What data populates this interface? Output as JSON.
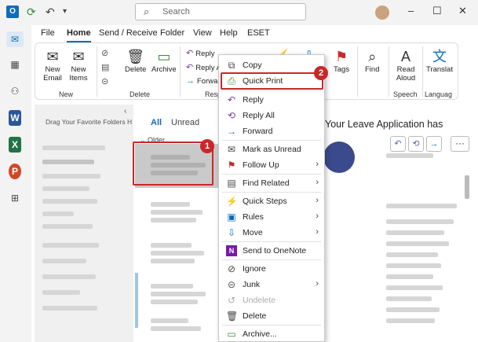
{
  "titlebar": {
    "search_placeholder": "Search",
    "undo_icon": "undo-icon",
    "refresh_icon": "refresh-icon",
    "minimize": "–",
    "maximize": "☐",
    "close": "✕"
  },
  "menu_tabs": [
    "File",
    "Home",
    "Send / Receive",
    "Folder",
    "View",
    "Help",
    "ESET"
  ],
  "ribbon": {
    "new_email": "New Email",
    "new_items": "New Items",
    "group_new": "New",
    "delete": "Delete",
    "archive": "Archive",
    "group_delete": "Delete",
    "reply": "Reply",
    "reply_all": "Reply A",
    "forward": "Forwar",
    "group_respond": "Resp",
    "tags": "Tags",
    "find": "Find",
    "read_aloud": "Read Aloud",
    "group_speech": "Speech",
    "translate": "Translat",
    "group_language": "Languag"
  },
  "folder_pane": {
    "drag_hint": "Drag Your Favorite Folders H"
  },
  "message_list": {
    "tab_all": "All",
    "tab_unread": "Unread",
    "group_older": "Older"
  },
  "reading_pane": {
    "subject": "Your Leave Application has"
  },
  "context_menu": {
    "items": [
      {
        "label": "Copy",
        "icon": "copy-icon",
        "submenu": false,
        "disabled": false
      },
      {
        "label": "Quick Print",
        "icon": "quick-print-icon",
        "submenu": false,
        "disabled": false
      },
      {
        "label": "Reply",
        "icon": "reply-icon",
        "submenu": false,
        "disabled": false
      },
      {
        "label": "Reply All",
        "icon": "reply-all-icon",
        "submenu": false,
        "disabled": false
      },
      {
        "label": "Forward",
        "icon": "forward-icon",
        "submenu": false,
        "disabled": false
      },
      {
        "label": "Mark as Unread",
        "icon": "mail-icon",
        "submenu": false,
        "disabled": false
      },
      {
        "label": "Follow Up",
        "icon": "flag-icon",
        "submenu": true,
        "disabled": false
      },
      {
        "label": "Find Related",
        "icon": "find-related-icon",
        "submenu": true,
        "disabled": false
      },
      {
        "label": "Quick Steps",
        "icon": "lightning-icon",
        "submenu": true,
        "disabled": false
      },
      {
        "label": "Rules",
        "icon": "rules-icon",
        "submenu": true,
        "disabled": false
      },
      {
        "label": "Move",
        "icon": "move-icon",
        "submenu": true,
        "disabled": false
      },
      {
        "label": "Send to OneNote",
        "icon": "onenote-icon",
        "submenu": false,
        "disabled": false
      },
      {
        "label": "Ignore",
        "icon": "ignore-icon",
        "submenu": false,
        "disabled": false
      },
      {
        "label": "Junk",
        "icon": "junk-icon",
        "submenu": true,
        "disabled": false
      },
      {
        "label": "Undelete",
        "icon": "undelete-icon",
        "submenu": false,
        "disabled": true
      },
      {
        "label": "Delete",
        "icon": "trash-icon",
        "submenu": false,
        "disabled": false
      },
      {
        "label": "Archive...",
        "icon": "archive-icon",
        "submenu": false,
        "disabled": false
      }
    ]
  },
  "callouts": {
    "first": "1",
    "second": "2"
  },
  "colors": {
    "accent": "#0f6cbd",
    "highlight": "#c9272a"
  }
}
